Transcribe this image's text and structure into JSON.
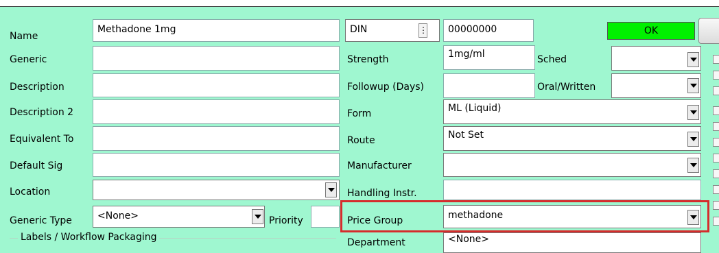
{
  "labels": {
    "name": "Name",
    "generic": "Generic",
    "description": "Description",
    "description2": "Description 2",
    "equivalent_to": "Equivalent To",
    "default_sig": "Default Sig",
    "location": "Location",
    "generic_type": "Generic Type",
    "priority": "Priority",
    "strength": "Strength",
    "followup_days": "Followup (Days)",
    "form": "Form",
    "route": "Route",
    "manufacturer": "Manufacturer",
    "handling_instr": "Handling Instr.",
    "price_group": "Price Group",
    "department": "Department",
    "sched": "Sched",
    "oral_written": "Oral/Written"
  },
  "values": {
    "name": "Methadone 1mg",
    "din_type": "DIN",
    "din_number": "00000000",
    "strength": "1mg/ml",
    "form": "ML (Liquid)",
    "route": "Not Set",
    "generic_type": "<None>",
    "price_group": "methadone",
    "department": "<None>"
  },
  "buttons": {
    "ok": "OK"
  },
  "group_box": {
    "title": "Labels / Workflow Packaging"
  },
  "colors": {
    "background": "#9ff7d0",
    "ok_button": "#00f000",
    "highlight_border": "#d62c2c"
  }
}
